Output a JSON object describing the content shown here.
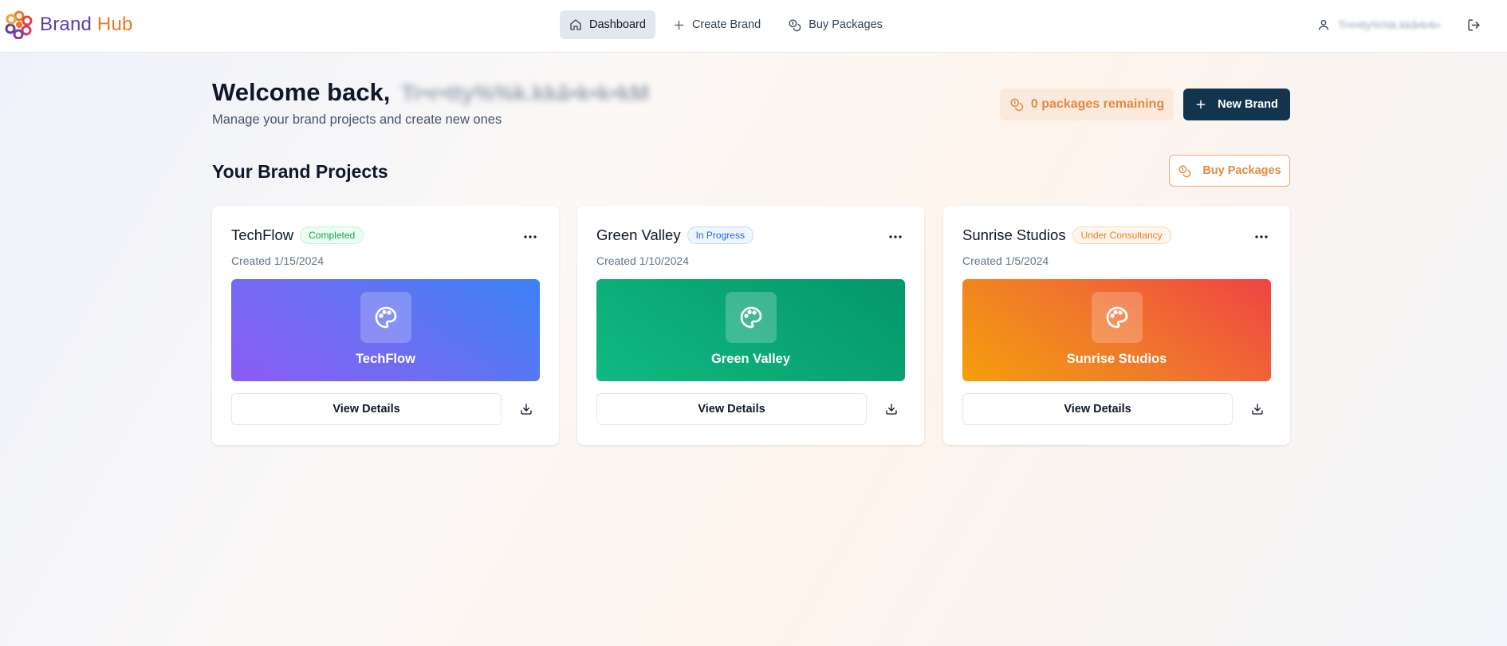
{
  "header": {
    "logo_part1": "Brand",
    "logo_part2": "Hub",
    "nav": [
      {
        "label": "Dashboard",
        "icon": "home-icon",
        "active": true
      },
      {
        "label": "Create Brand",
        "icon": "plus-icon",
        "active": false
      },
      {
        "label": "Buy Packages",
        "icon": "coins-icon",
        "active": false
      }
    ],
    "user_name": "Tr•r•tty%%k.kkâ•k•k•k"
  },
  "welcome": {
    "title": "Welcome back,",
    "user_name": "Tr•r•tty%%k.kkâ•k•k•kM",
    "subtitle": "Manage your brand projects and create new ones"
  },
  "packages": {
    "remaining_label": "0 packages remaining"
  },
  "actions": {
    "new_brand_label": "New Brand",
    "buy_packages_label": "Buy Packages"
  },
  "section_title": "Your Brand Projects",
  "projects": [
    {
      "name": "TechFlow",
      "status": "Completed",
      "status_color": "#16a34a",
      "created": "Created 1/15/2024",
      "banner_name": "TechFlow",
      "view_label": "View Details"
    },
    {
      "name": "Green Valley",
      "status": "In Progress",
      "status_color": "#2563eb",
      "created": "Created 1/10/2024",
      "banner_name": "Green Valley",
      "view_label": "View Details"
    },
    {
      "name": "Sunrise Studios",
      "status": "Under Consultancy",
      "status_color": "#ea7a22",
      "created": "Created 1/5/2024",
      "banner_name": "Sunrise Studios",
      "view_label": "View Details"
    }
  ],
  "colors": {
    "primary": "#12344d",
    "accent": "#ea7a22",
    "logo_purple": "#5b3fa6"
  }
}
